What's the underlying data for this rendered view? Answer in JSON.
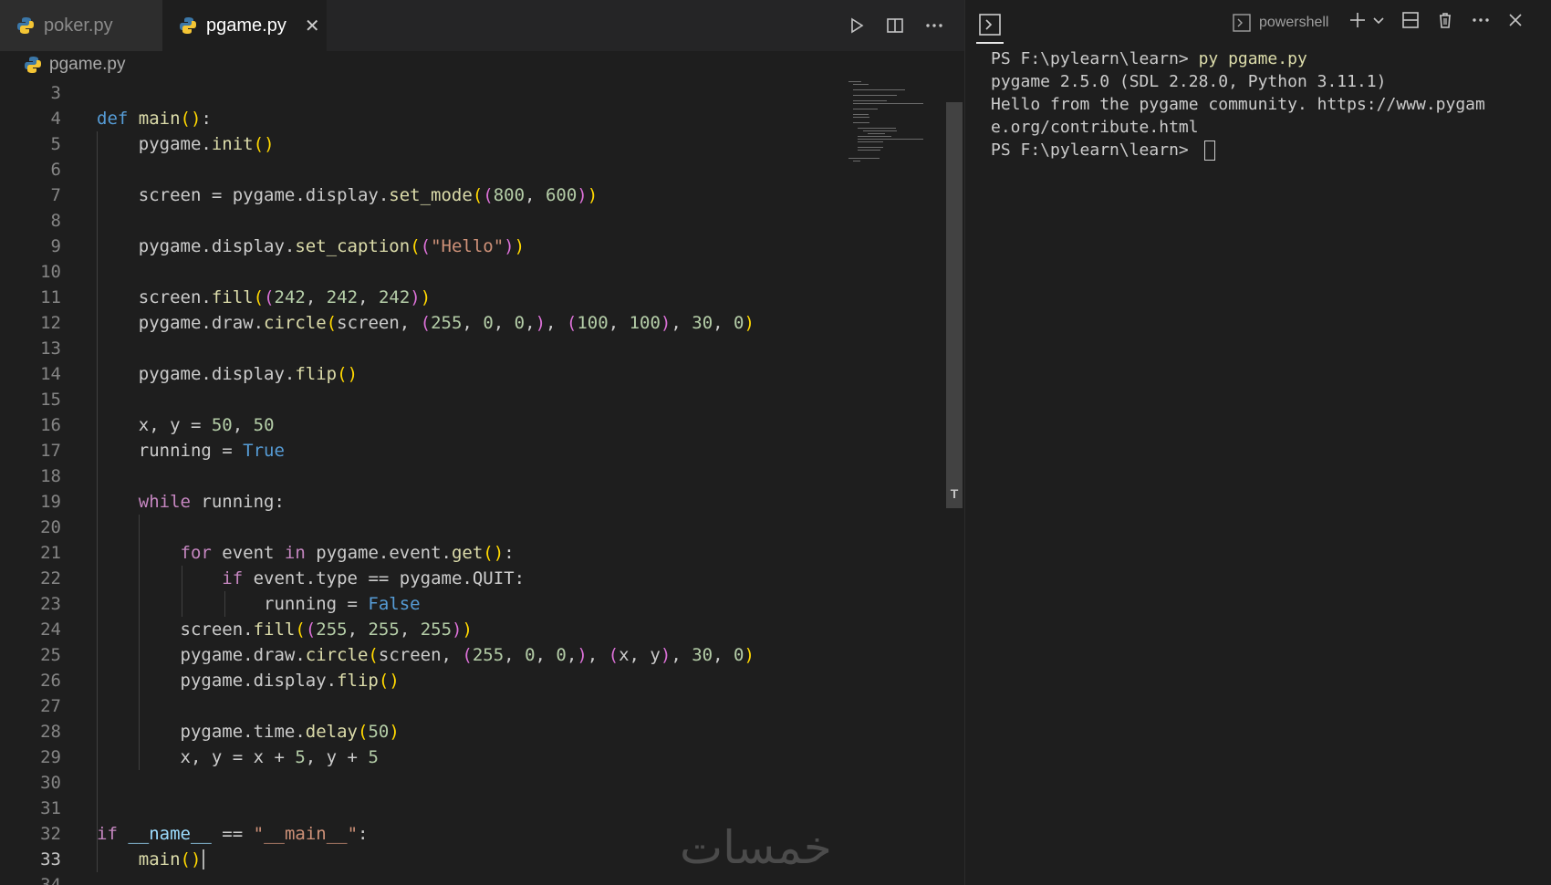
{
  "tabs": [
    {
      "label": "poker.py",
      "active": false
    },
    {
      "label": "pgame.py",
      "active": true
    }
  ],
  "breadcrumb": "pgame.py",
  "code_lines": [
    {
      "n": "3",
      "text": ""
    },
    {
      "n": "4",
      "text": "def main():"
    },
    {
      "n": "5",
      "text": "    pygame.init()"
    },
    {
      "n": "6",
      "text": ""
    },
    {
      "n": "7",
      "text": "    screen = pygame.display.set_mode((800, 600))"
    },
    {
      "n": "8",
      "text": ""
    },
    {
      "n": "9",
      "text": "    pygame.display.set_caption((\"Hello\"))"
    },
    {
      "n": "10",
      "text": ""
    },
    {
      "n": "11",
      "text": "    screen.fill((242, 242, 242))"
    },
    {
      "n": "12",
      "text": "    pygame.draw.circle(screen, (255, 0, 0,), (100, 100), 30, 0)"
    },
    {
      "n": "13",
      "text": ""
    },
    {
      "n": "14",
      "text": "    pygame.display.flip()"
    },
    {
      "n": "15",
      "text": ""
    },
    {
      "n": "16",
      "text": "    x, y = 50, 50"
    },
    {
      "n": "17",
      "text": "    running = True"
    },
    {
      "n": "18",
      "text": ""
    },
    {
      "n": "19",
      "text": "    while running:"
    },
    {
      "n": "20",
      "text": ""
    },
    {
      "n": "21",
      "text": "        for event in pygame.event.get():"
    },
    {
      "n": "22",
      "text": "            if event.type == pygame.QUIT:"
    },
    {
      "n": "23",
      "text": "                running = False"
    },
    {
      "n": "24",
      "text": "        screen.fill((255, 255, 255))"
    },
    {
      "n": "25",
      "text": "        pygame.draw.circle(screen, (255, 0, 0,), (x, y), 30, 0)"
    },
    {
      "n": "26",
      "text": "        pygame.display.flip()"
    },
    {
      "n": "27",
      "text": ""
    },
    {
      "n": "28",
      "text": "        pygame.time.delay(50)"
    },
    {
      "n": "29",
      "text": "        x, y = x + 5, y + 5"
    },
    {
      "n": "30",
      "text": ""
    },
    {
      "n": "31",
      "text": ""
    },
    {
      "n": "32",
      "text": "if __name__ == \"__main__\":"
    },
    {
      "n": "33",
      "text": "    main()"
    },
    {
      "n": "34",
      "text": ""
    }
  ],
  "current_line": "33",
  "terminal": {
    "shell_label": "powershell",
    "prompt1": "PS F:\\pylearn\\learn> ",
    "command1": "py pgame.py",
    "output1": "pygame 2.5.0 (SDL 2.28.0, Python 3.11.1)",
    "output2": "Hello from the pygame community. https://www.pygam",
    "output3": "e.org/contribute.html",
    "prompt2": "PS F:\\pylearn\\learn> "
  },
  "watermark": "خمسات",
  "colors": {
    "keyword": "#569cd6",
    "control": "#c586c0",
    "function": "#dcdcaa",
    "number": "#b5cea8",
    "string": "#ce9178",
    "bracket": "#ffd700"
  }
}
